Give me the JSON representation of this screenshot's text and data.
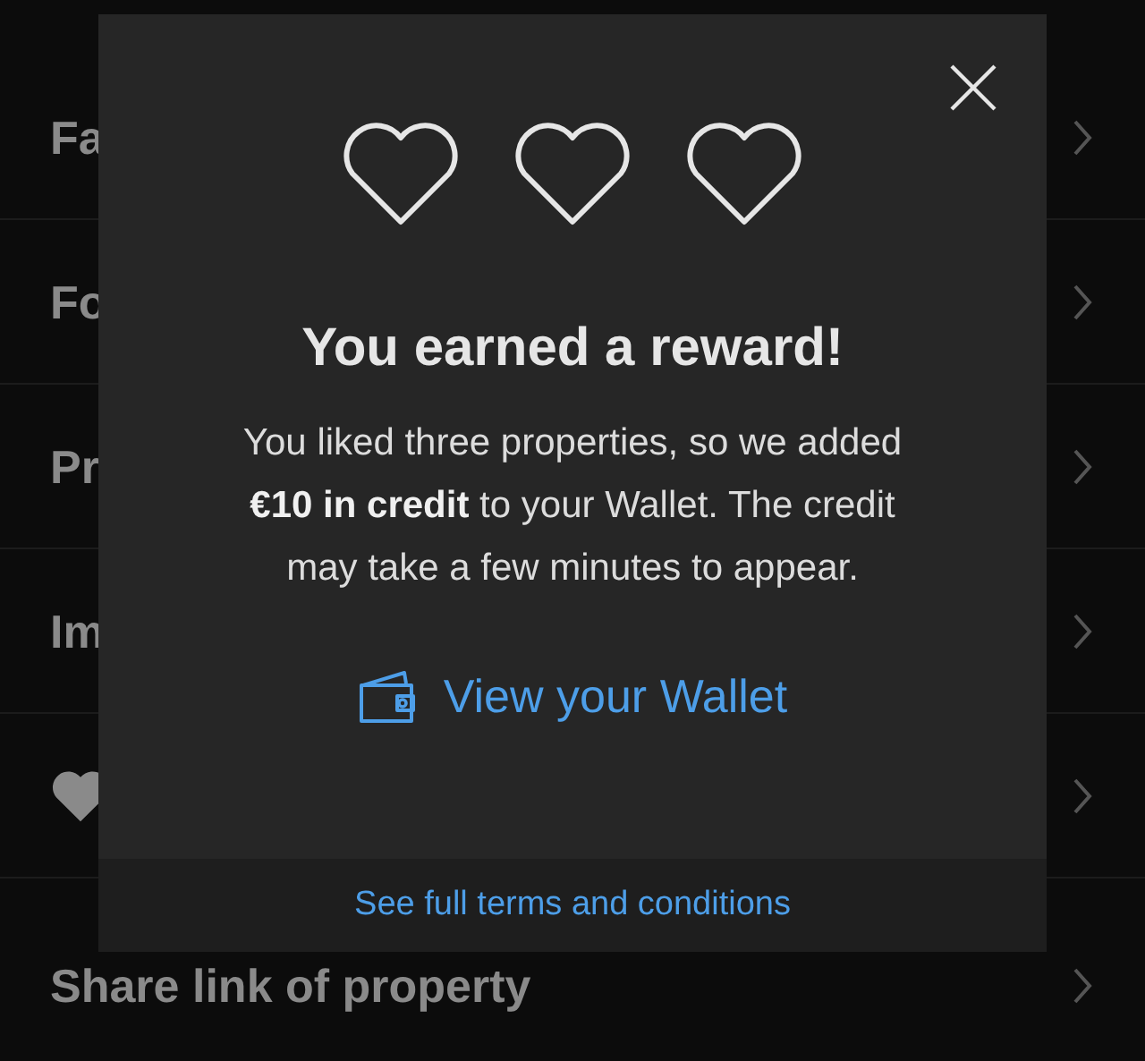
{
  "list": [
    {
      "kind": "text",
      "label": "Fa"
    },
    {
      "kind": "text",
      "label": "Fo"
    },
    {
      "kind": "text",
      "label": "Pr"
    },
    {
      "kind": "text",
      "label": "Im"
    },
    {
      "kind": "heart"
    },
    {
      "kind": "text",
      "label": "Share link of property"
    }
  ],
  "dialog": {
    "title": "You earned a reward!",
    "message": "You liked three properties, so we added **€10 in credit** to your Wallet. The credit may take a few minutes to appear.",
    "action": "View your Wallet",
    "footer_link": "See full terms and conditions"
  }
}
